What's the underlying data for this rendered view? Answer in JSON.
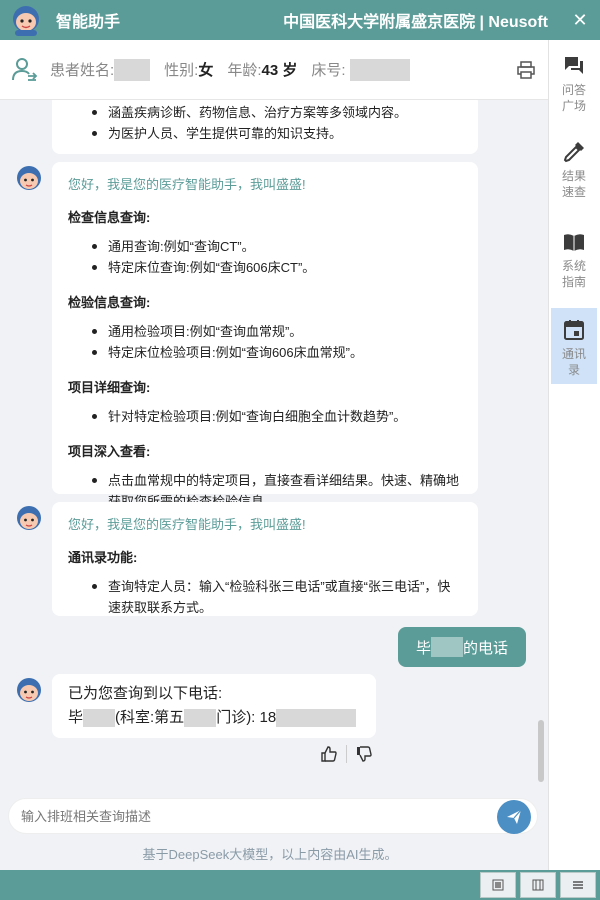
{
  "titlebar": {
    "app_title": "智能助手",
    "hospital": "中国医科大学附属盛京医院 | Neusoft",
    "close": "✕"
  },
  "patient": {
    "name_label": "患者姓名:",
    "gender_label": "性别:",
    "gender": "女",
    "age_label": "年龄:",
    "age": "43 岁",
    "bed_label": "床号:"
  },
  "sidebar": {
    "items": [
      {
        "label": "问答广场",
        "icon": "chat-icon"
      },
      {
        "label": "结果速查",
        "icon": "dropper-icon"
      },
      {
        "label": "系统指南",
        "icon": "book-icon"
      },
      {
        "label": "通讯录",
        "icon": "calendar-icon",
        "active": true
      }
    ]
  },
  "messages": {
    "intro_tail": [
      "涵盖疾病诊断、药物信息、治疗方案等多领域内容。",
      "为医护人员、学生提供可靠的知识支持。"
    ],
    "guide": {
      "greeting": "您好，我是您的医疗智能助手，我叫盛盛!",
      "sections": [
        {
          "title": "检查信息查询:",
          "items": [
            "通用查询:例如“查询CT”。",
            "特定床位查询:例如“查询606床CT”。"
          ]
        },
        {
          "title": "检验信息查询:",
          "items": [
            "通用检验项目:例如“查询血常规”。",
            "特定床位检验项目:例如“查询606床血常规”。"
          ]
        },
        {
          "title": "项目详细查询:",
          "items": [
            "针对特定检验项目:例如“查询白细胞全血计数趋势”。"
          ]
        },
        {
          "title": "项目深入查看:",
          "items": [
            "点击血常规中的特定项目，直接查看详细结果。快速、精确地获取您所需的检查检验信息。"
          ]
        }
      ]
    },
    "contacts": {
      "greeting": "您好，我是您的医疗智能助手，我叫盛盛!",
      "title": "通讯录功能:",
      "items": [
        "查询特定人员：输入“检验科张三电话”或直接“张三电话”，快速获取联系方式。"
      ]
    },
    "user_query": {
      "prefix": "毕",
      "suffix": "的电话"
    },
    "reply": {
      "line1": "已为您查询到以下电话:",
      "p1": "毕",
      "p2": "(科室:第五",
      "p3": "门诊): 18"
    }
  },
  "input": {
    "placeholder": "输入排班相关查询描述"
  },
  "disclaimer": "基于DeepSeek大模型，以上内容由AI生成。",
  "colors": {
    "theme": "#5b9c98",
    "accent_text": "#5b9c98",
    "send_button": "#4b8fc4",
    "sidebar_active": "#cfe2f7"
  }
}
